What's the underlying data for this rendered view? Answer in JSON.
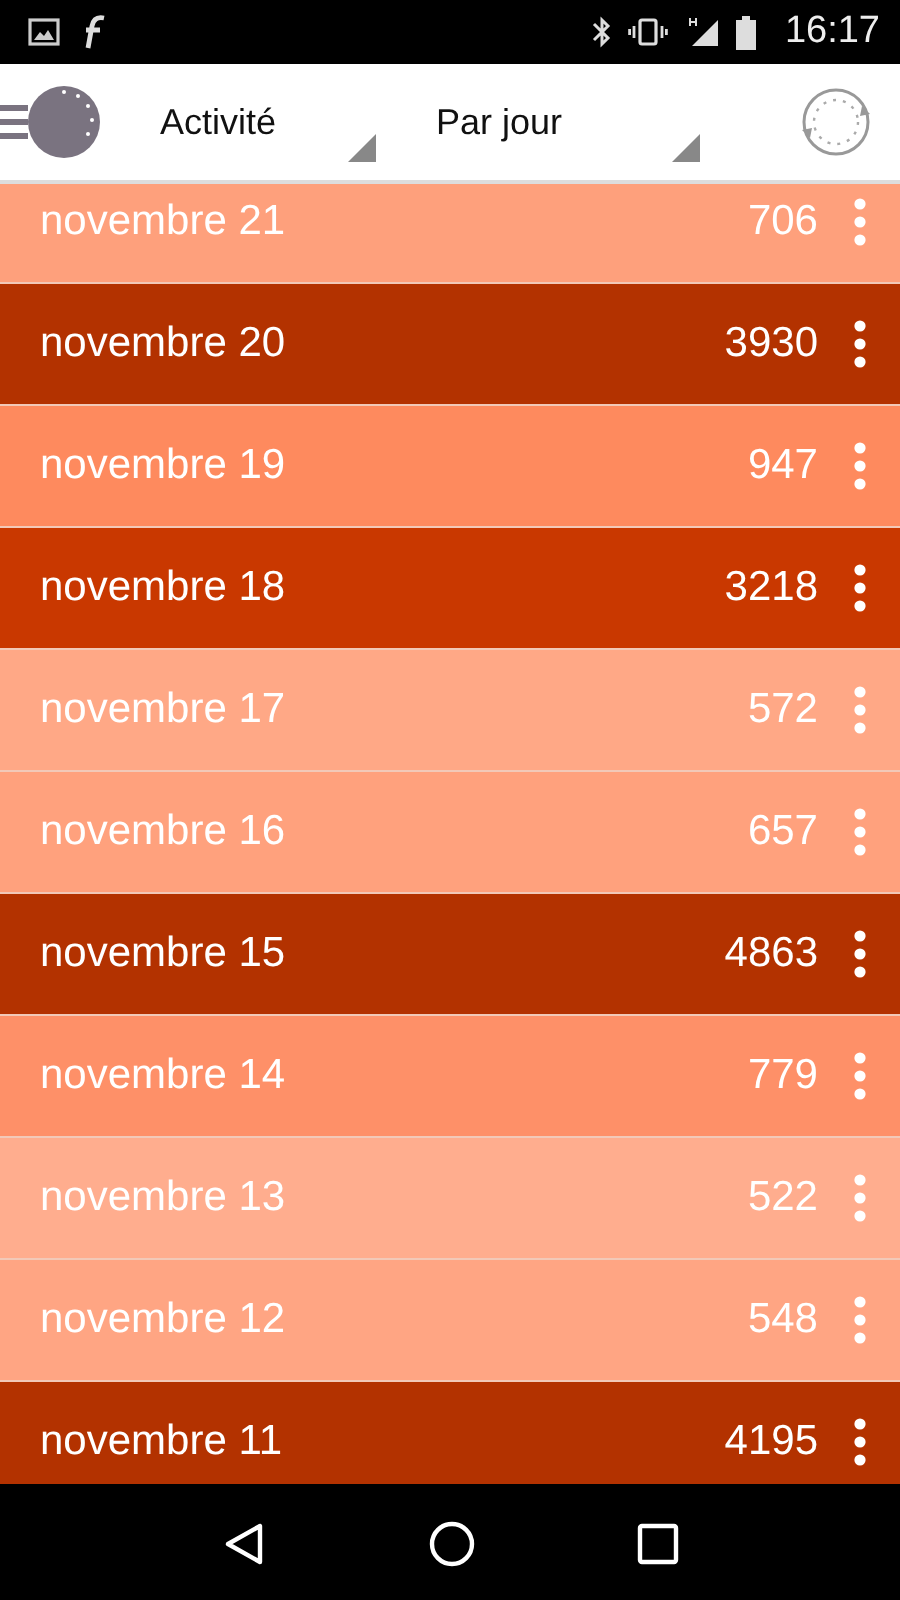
{
  "status_bar": {
    "time": "16:17"
  },
  "toolbar": {
    "dropdowns": [
      {
        "label": "Activité"
      },
      {
        "label": "Par jour"
      }
    ]
  },
  "rows": [
    {
      "date": "novembre 21",
      "value": "706",
      "color": "#fea07c"
    },
    {
      "date": "novembre 20",
      "value": "3930",
      "color": "#b33200"
    },
    {
      "date": "novembre 19",
      "value": "947",
      "color": "#fe8a5e"
    },
    {
      "date": "novembre 18",
      "value": "3218",
      "color": "#c93800"
    },
    {
      "date": "novembre 17",
      "value": "572",
      "color": "#ffa886"
    },
    {
      "date": "novembre 16",
      "value": "657",
      "color": "#ffa17d"
    },
    {
      "date": "novembre 15",
      "value": "4863",
      "color": "#b33200"
    },
    {
      "date": "novembre 14",
      "value": "779",
      "color": "#fe9068"
    },
    {
      "date": "novembre 13",
      "value": "522",
      "color": "#ffad8e"
    },
    {
      "date": "novembre 12",
      "value": "548",
      "color": "#ffa583"
    },
    {
      "date": "novembre 11",
      "value": "4195",
      "color": "#b33200"
    }
  ]
}
